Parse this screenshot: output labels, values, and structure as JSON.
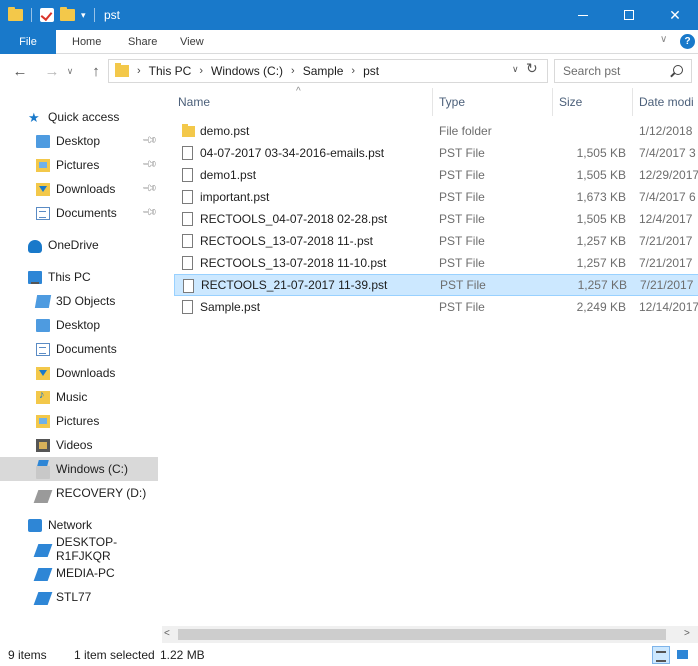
{
  "window": {
    "title": "pst",
    "accent_color": "#1979ca"
  },
  "ribbon": {
    "tabs": [
      {
        "label": "File"
      },
      {
        "label": "Home"
      },
      {
        "label": "Share"
      },
      {
        "label": "View"
      }
    ]
  },
  "address": {
    "breadcrumbs": [
      "This PC",
      "Windows (C:)",
      "Sample",
      "pst"
    ],
    "search_placeholder": "Search pst"
  },
  "nav": {
    "quick_access": "Quick access",
    "quick_items": [
      "Desktop",
      "Pictures",
      "Downloads",
      "Documents"
    ],
    "onedrive": "OneDrive",
    "this_pc": "This PC",
    "pc_items": [
      "3D Objects",
      "Desktop",
      "Documents",
      "Downloads",
      "Music",
      "Pictures",
      "Videos",
      "Windows (C:)",
      "RECOVERY (D:)"
    ],
    "network": "Network",
    "network_items": [
      "DESKTOP-R1FJKQR",
      "MEDIA-PC",
      "STL77"
    ],
    "selected": "Windows (C:)"
  },
  "columns": {
    "name": "Name",
    "type": "Type",
    "size": "Size",
    "date": "Date modi"
  },
  "files": [
    {
      "name": "demo.pst",
      "type": "File folder",
      "size": "",
      "date": "1/12/2018",
      "icon": "folder-icon"
    },
    {
      "name": "04-07-2017 03-34-2016-emails.pst",
      "type": "PST File",
      "size": "1,505 KB",
      "date": "7/4/2017 3",
      "icon": "file-icon"
    },
    {
      "name": "demo1.pst",
      "type": "PST File",
      "size": "1,505 KB",
      "date": "12/29/2017",
      "icon": "file-icon"
    },
    {
      "name": "important.pst",
      "type": "PST File",
      "size": "1,673 KB",
      "date": "7/4/2017 6",
      "icon": "file-icon"
    },
    {
      "name": "RECTOOLS_04-07-2018 02-28.pst",
      "type": "PST File",
      "size": "1,505 KB",
      "date": "12/4/2017",
      "icon": "file-icon"
    },
    {
      "name": "RECTOOLS_13-07-2018 11-.pst",
      "type": "PST File",
      "size": "1,257 KB",
      "date": "7/21/2017",
      "icon": "file-icon"
    },
    {
      "name": "RECTOOLS_13-07-2018 11-10.pst",
      "type": "PST File",
      "size": "1,257 KB",
      "date": "7/21/2017",
      "icon": "file-icon"
    },
    {
      "name": "RECTOOLS_21-07-2017 11-39.pst",
      "type": "PST File",
      "size": "1,257 KB",
      "date": "7/21/2017",
      "icon": "file-icon",
      "selected": true
    },
    {
      "name": "Sample.pst",
      "type": "PST File",
      "size": "2,249 KB",
      "date": "12/14/2017",
      "icon": "file-icon"
    }
  ],
  "status": {
    "item_count": "9 items",
    "selection": "1 item selected",
    "selection_size": "1.22 MB"
  }
}
